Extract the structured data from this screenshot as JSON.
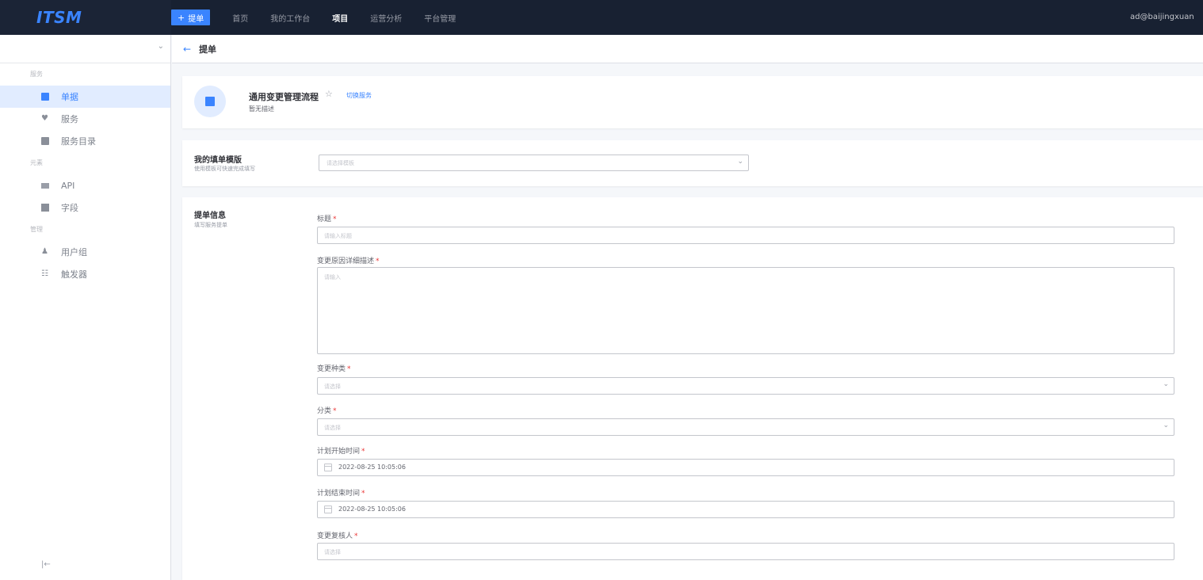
{
  "topnav": {
    "logo": "ITSM",
    "create_label": "提单",
    "items": [
      "首页",
      "我的工作台",
      "项目",
      "运营分析",
      "平台管理"
    ],
    "active_item": "项目",
    "user": "ad@baijingxuan"
  },
  "sidebar": {
    "groups": {
      "service": "服务",
      "element": "元素",
      "manage": "管理"
    },
    "items": {
      "tickets": "单据",
      "services": "服务",
      "catalog": "服务目录",
      "api": "API",
      "fields": "字段",
      "user_groups": "用户组",
      "triggers": "触发器"
    },
    "active": "单据"
  },
  "subheader": {
    "back_icon": "arrow-left-icon",
    "title": "提单"
  },
  "service": {
    "title": "通用变更管理流程",
    "switch_label": "切换服务",
    "description": "暂无描述"
  },
  "template": {
    "title": "我的填单模版",
    "desc": "使用模板可快速完成填写",
    "placeholder": "请选择模板"
  },
  "form": {
    "title": "提单信息",
    "desc": "填写服务提单",
    "fields": {
      "title": {
        "label": "标题",
        "placeholder": "请输入标题"
      },
      "reason": {
        "label": "变更原因详细描述",
        "placeholder": "请输入"
      },
      "change_type": {
        "label": "变更种类",
        "placeholder": "请选择"
      },
      "category": {
        "label": "分类",
        "placeholder": "请选择"
      },
      "start_time": {
        "label": "计划开始时间",
        "value": "2022-08-25 10:05:06"
      },
      "end_time": {
        "label": "计划结束时间",
        "value": "2022-08-25 10:05:06"
      },
      "reviewer": {
        "label": "变更复核人",
        "placeholder": "请选择"
      }
    },
    "required_mark": "*"
  },
  "colors": {
    "primary": "#3a84ff",
    "topbar": "#182132",
    "required": "#ea3636"
  }
}
